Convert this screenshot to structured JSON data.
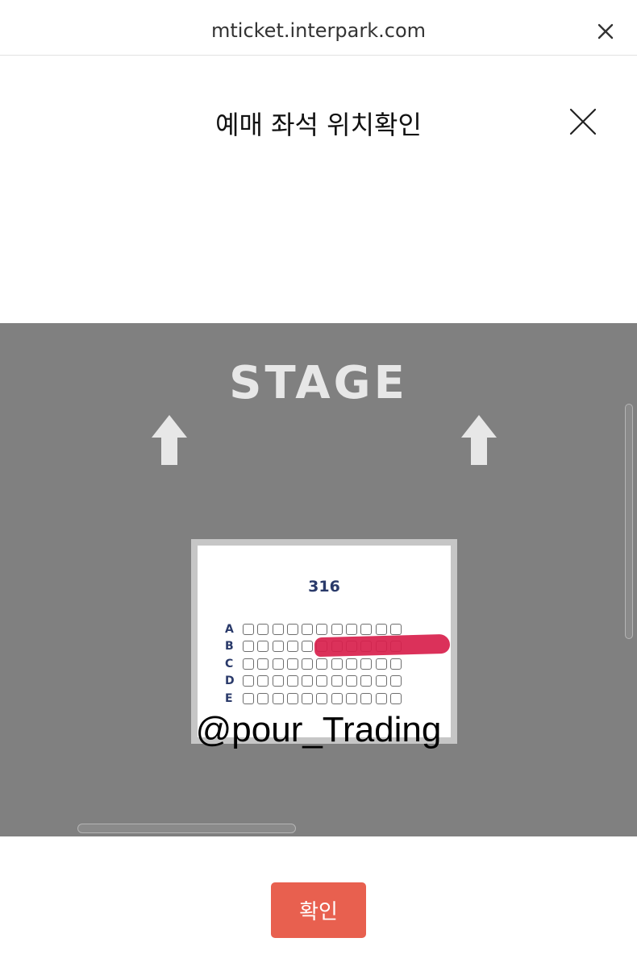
{
  "browser": {
    "url": "mticket.interpark.com"
  },
  "modal": {
    "title": "예매 좌석 위치확인"
  },
  "map": {
    "stage_label": "STAGE",
    "section": {
      "number": "316",
      "rows": [
        {
          "label": "A",
          "seat_count": 11
        },
        {
          "label": "B",
          "seat_count": 11
        },
        {
          "label": "C",
          "seat_count": 11
        },
        {
          "label": "D",
          "seat_count": 11
        },
        {
          "label": "E",
          "seat_count": 11
        }
      ]
    },
    "watermark": "@pour_Trading",
    "colors": {
      "background": "#808080",
      "redaction": "#d8204c"
    }
  },
  "footer": {
    "confirm_label": "확인",
    "confirm_color": "#e8604f"
  }
}
